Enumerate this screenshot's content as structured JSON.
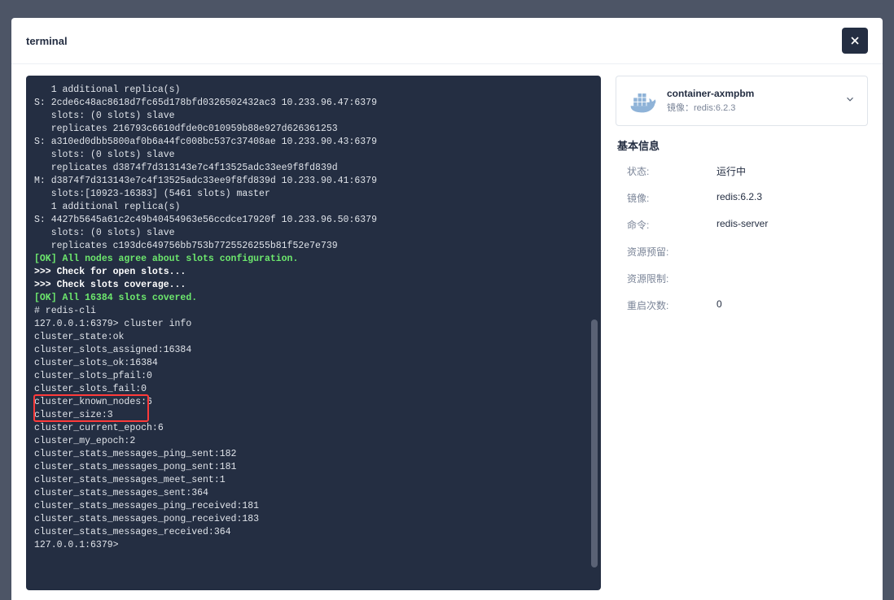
{
  "modal": {
    "title": "terminal"
  },
  "terminal": {
    "lines": [
      {
        "text": "   1 additional replica(s)"
      },
      {
        "text": "S: 2cde6c48ac8618d7fc65d178bfd0326502432ac3 10.233.96.47:6379"
      },
      {
        "text": "   slots: (0 slots) slave"
      },
      {
        "text": "   replicates 216793c6610dfde0c010959b88e927d626361253"
      },
      {
        "text": "S: a310ed0dbb5800af0b6a44fc008bc537c37408ae 10.233.90.43:6379"
      },
      {
        "text": "   slots: (0 slots) slave"
      },
      {
        "text": "   replicates d3874f7d313143e7c4f13525adc33ee9f8fd839d"
      },
      {
        "text": "M: d3874f7d313143e7c4f13525adc33ee9f8fd839d 10.233.90.41:6379"
      },
      {
        "text": "   slots:[10923-16383] (5461 slots) master"
      },
      {
        "text": "   1 additional replica(s)"
      },
      {
        "text": "S: 4427b5645a61c2c49b40454963e56ccdce17920f 10.233.96.50:6379"
      },
      {
        "text": "   slots: (0 slots) slave"
      },
      {
        "text": "   replicates c193dc649756bb753b7725526255b81f52e7e739"
      },
      {
        "text": "[OK] All nodes agree about slots configuration.",
        "cls": "green"
      },
      {
        "text": ">>> Check for open slots...",
        "cls": "bold"
      },
      {
        "text": ">>> Check slots coverage...",
        "cls": "bold"
      },
      {
        "text": "[OK] All 16384 slots covered.",
        "cls": "green"
      },
      {
        "text": "# redis-cli"
      },
      {
        "text": "127.0.0.1:6379> cluster info"
      },
      {
        "text": "cluster_state:ok"
      },
      {
        "text": "cluster_slots_assigned:16384"
      },
      {
        "text": "cluster_slots_ok:16384"
      },
      {
        "text": "cluster_slots_pfail:0"
      },
      {
        "text": "cluster_slots_fail:0"
      },
      {
        "text": "cluster_known_nodes:6"
      },
      {
        "text": "cluster_size:3"
      },
      {
        "text": "cluster_current_epoch:6"
      },
      {
        "text": "cluster_my_epoch:2"
      },
      {
        "text": "cluster_stats_messages_ping_sent:182"
      },
      {
        "text": "cluster_stats_messages_pong_sent:181"
      },
      {
        "text": "cluster_stats_messages_meet_sent:1"
      },
      {
        "text": "cluster_stats_messages_sent:364"
      },
      {
        "text": "cluster_stats_messages_ping_received:181"
      },
      {
        "text": "cluster_stats_messages_pong_received:183"
      },
      {
        "text": "cluster_stats_messages_received:364"
      },
      {
        "text": "127.0.0.1:6379> "
      }
    ]
  },
  "container": {
    "name": "container-axmpbm",
    "sub_prefix": "镜像：",
    "sub_value": "redis:6.2.3"
  },
  "info": {
    "title": "基本信息",
    "rows": [
      {
        "label": "状态:",
        "value": "运行中"
      },
      {
        "label": "镜像:",
        "value": "redis:6.2.3"
      },
      {
        "label": "命令:",
        "value": "redis-server"
      },
      {
        "label": "资源预留:",
        "value": ""
      },
      {
        "label": "资源限制:",
        "value": ""
      },
      {
        "label": "重启次数:",
        "value": "0"
      }
    ]
  }
}
